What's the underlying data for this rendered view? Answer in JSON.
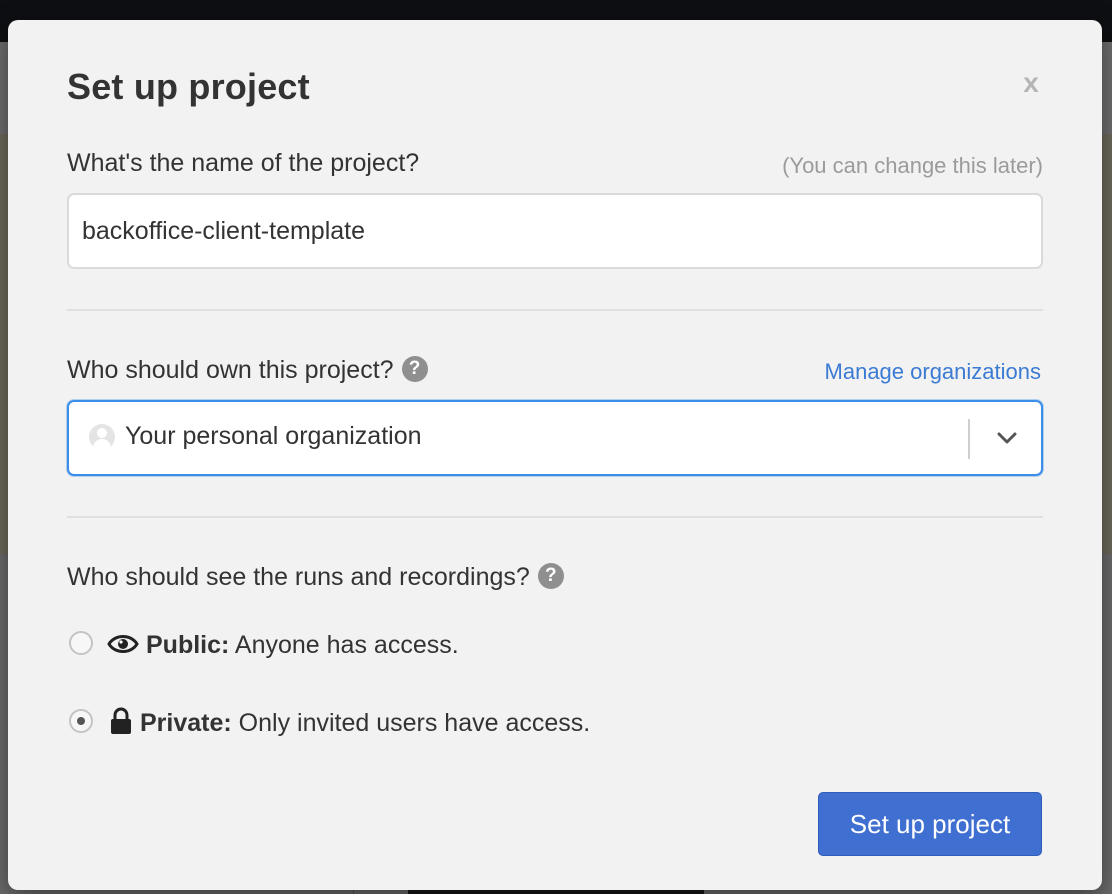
{
  "modal": {
    "title": "Set up project",
    "close_label": "x"
  },
  "name_section": {
    "label": "What's the name of the project?",
    "hint": "(You can change this later)",
    "input_value": "backoffice-client-template"
  },
  "owner_section": {
    "label": "Who should own this project?",
    "help_glyph": "?",
    "manage_link": "Manage organizations",
    "selected_value": "Your personal organization"
  },
  "visibility_section": {
    "label": "Who should see the runs and recordings?",
    "help_glyph": "?",
    "options": [
      {
        "name": "Public:",
        "description": "Anyone has access.",
        "icon": "eye-icon",
        "checked": false
      },
      {
        "name": "Private:",
        "description": "Only invited users have access.",
        "icon": "lock-icon",
        "checked": true
      }
    ]
  },
  "submit_label": "Set up project",
  "colors": {
    "primary": "#3f6fd1",
    "link": "#3b7bd4",
    "focus": "#3d8ee8"
  }
}
